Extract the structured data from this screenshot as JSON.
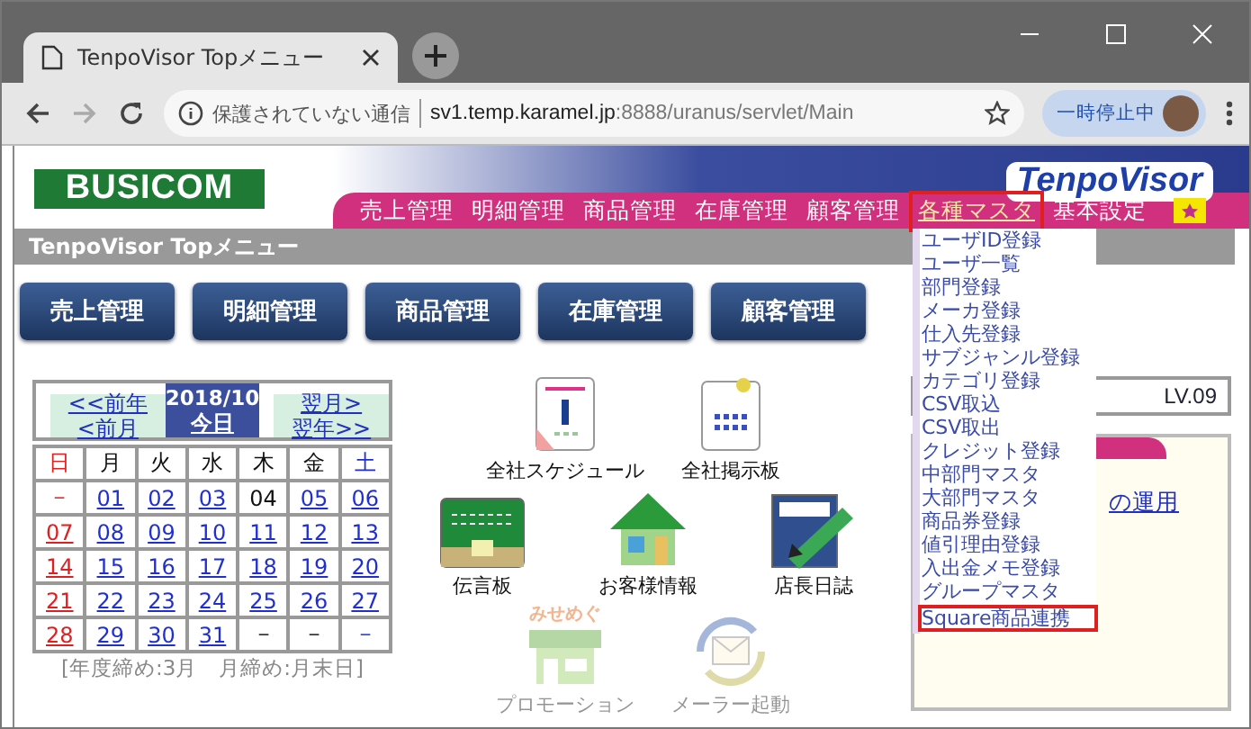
{
  "browser": {
    "tab_title": "TenpoVisor Topメニュー",
    "security_label": "保護されていない通信",
    "url_host": "sv1.temp.karamel.jp",
    "url_path": ":8888/uranus/servlet/Main",
    "profile_label": "一時停止中"
  },
  "header": {
    "company_logo": "BUSICOM",
    "product_logo": "TenpoVisor"
  },
  "nav": [
    {
      "label": "売上管理",
      "selected": false,
      "highlighted": false
    },
    {
      "label": "明細管理",
      "selected": false,
      "highlighted": false
    },
    {
      "label": "商品管理",
      "selected": false,
      "highlighted": false
    },
    {
      "label": "在庫管理",
      "selected": false,
      "highlighted": false
    },
    {
      "label": "顧客管理",
      "selected": false,
      "highlighted": false
    },
    {
      "label": "各種マスタ",
      "selected": true,
      "highlighted": true
    },
    {
      "label": "基本設定",
      "selected": false,
      "highlighted": false
    }
  ],
  "dropdown": [
    {
      "label": "ユーザID登録",
      "highlighted": false
    },
    {
      "label": "ユーザ一覧",
      "highlighted": false
    },
    {
      "label": "部門登録",
      "highlighted": false
    },
    {
      "label": "メーカ登録",
      "highlighted": false
    },
    {
      "label": "仕入先登録",
      "highlighted": false
    },
    {
      "label": "サブジャンル登録",
      "highlighted": false
    },
    {
      "label": "カテゴリ登録",
      "highlighted": false
    },
    {
      "label": "CSV取込",
      "highlighted": false
    },
    {
      "label": "CSV取出",
      "highlighted": false
    },
    {
      "label": "クレジット登録",
      "highlighted": false
    },
    {
      "label": "中部門マスタ",
      "highlighted": false
    },
    {
      "label": "大部門マスタ",
      "highlighted": false
    },
    {
      "label": "商品券登録",
      "highlighted": false
    },
    {
      "label": "値引理由登録",
      "highlighted": false
    },
    {
      "label": "入出金メモ登録",
      "highlighted": false
    },
    {
      "label": "グループマスタ",
      "highlighted": false
    },
    {
      "label": "Square商品連携",
      "highlighted": true
    }
  ],
  "page_title": "TenpoVisor Topメニュー",
  "buttons": [
    "売上管理",
    "明細管理",
    "商品管理",
    "在庫管理",
    "顧客管理"
  ],
  "calendar": {
    "prev_year": "<<前年",
    "prev_month": "<前月",
    "month": "2018/10",
    "today": "今日",
    "next_month": "翌月>",
    "next_year": "翌年>>",
    "weekdays": [
      "日",
      "月",
      "火",
      "水",
      "木",
      "金",
      "土"
    ],
    "weeks": [
      [
        {
          "text": "－",
          "link": false
        },
        {
          "text": "01",
          "link": true
        },
        {
          "text": "02",
          "link": true
        },
        {
          "text": "03",
          "link": true
        },
        {
          "text": "04",
          "link": false
        },
        {
          "text": "05",
          "link": true
        },
        {
          "text": "06",
          "link": true
        }
      ],
      [
        {
          "text": "07",
          "link": true
        },
        {
          "text": "08",
          "link": true
        },
        {
          "text": "09",
          "link": true
        },
        {
          "text": "10",
          "link": true
        },
        {
          "text": "11",
          "link": true
        },
        {
          "text": "12",
          "link": true
        },
        {
          "text": "13",
          "link": true
        }
      ],
      [
        {
          "text": "14",
          "link": true
        },
        {
          "text": "15",
          "link": true
        },
        {
          "text": "16",
          "link": true
        },
        {
          "text": "17",
          "link": true
        },
        {
          "text": "18",
          "link": true
        },
        {
          "text": "19",
          "link": true
        },
        {
          "text": "20",
          "link": true
        }
      ],
      [
        {
          "text": "21",
          "link": true
        },
        {
          "text": "22",
          "link": true
        },
        {
          "text": "23",
          "link": true
        },
        {
          "text": "24",
          "link": true
        },
        {
          "text": "25",
          "link": true
        },
        {
          "text": "26",
          "link": true
        },
        {
          "text": "27",
          "link": true
        }
      ],
      [
        {
          "text": "28",
          "link": true
        },
        {
          "text": "29",
          "link": true
        },
        {
          "text": "30",
          "link": true
        },
        {
          "text": "31",
          "link": true
        },
        {
          "text": "－",
          "link": false
        },
        {
          "text": "－",
          "link": false
        },
        {
          "text": "－",
          "link": false
        }
      ]
    ],
    "note": "[年度締め:3月　月締め:月末日]"
  },
  "apps": [
    {
      "kind": "schedule",
      "label": "全社スケジュール",
      "disabled": false
    },
    {
      "kind": "bulletin",
      "label": "全社掲示板",
      "disabled": false
    },
    {
      "kind": "board",
      "label": "伝言板",
      "disabled": false
    },
    {
      "kind": "customer",
      "label": "お客様情報",
      "disabled": false
    },
    {
      "kind": "diary",
      "label": "店長日誌",
      "disabled": false
    },
    {
      "kind": "promotion",
      "label": "プロモーション",
      "badge": "みせめぐ",
      "disabled": true
    },
    {
      "kind": "mailer",
      "label": "メーラー起動",
      "disabled": true
    }
  ],
  "side_panel": {
    "level": "LV.09",
    "link": "の運用"
  }
}
